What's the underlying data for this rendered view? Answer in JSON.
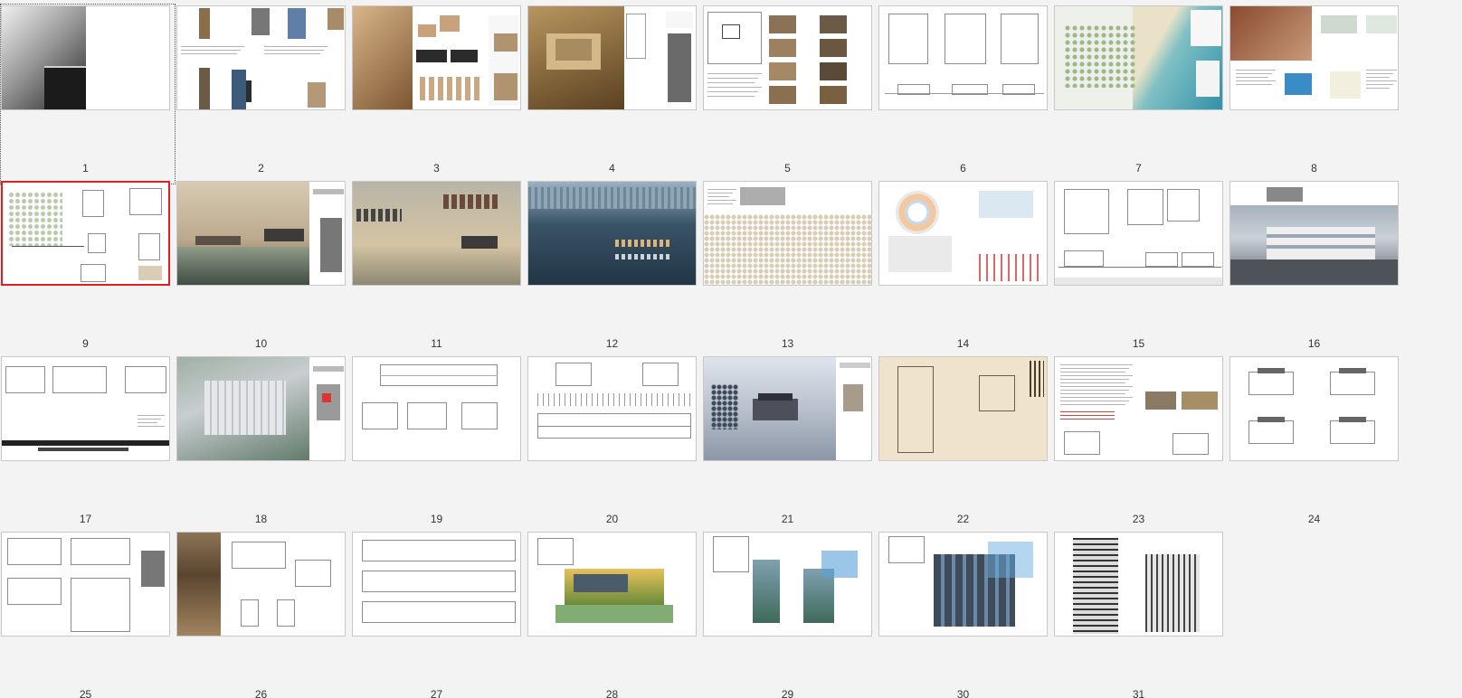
{
  "view": "slide-sorter",
  "selected_slide": 9,
  "slides": [
    {
      "number": "1",
      "theme": "gradient-title"
    },
    {
      "number": "2",
      "theme": "photo-collage"
    },
    {
      "number": "3",
      "theme": "model-photos"
    },
    {
      "number": "4",
      "theme": "model-aerial"
    },
    {
      "number": "5",
      "theme": "analysis-grid"
    },
    {
      "number": "6",
      "theme": "plans-sections"
    },
    {
      "number": "7",
      "theme": "site-plan-coast"
    },
    {
      "number": "8",
      "theme": "urban-analysis"
    },
    {
      "number": "9",
      "theme": "floor-plans"
    },
    {
      "number": "10",
      "theme": "waterfront-render"
    },
    {
      "number": "11",
      "theme": "waterfront-diagram"
    },
    {
      "number": "12",
      "theme": "night-bay"
    },
    {
      "number": "13",
      "theme": "sketch-map"
    },
    {
      "number": "14",
      "theme": "circle-diagram"
    },
    {
      "number": "15",
      "theme": "plans-elevations"
    },
    {
      "number": "16",
      "theme": "street-photo"
    },
    {
      "number": "17",
      "theme": "long-plans"
    },
    {
      "number": "18",
      "theme": "factory-aerial"
    },
    {
      "number": "19",
      "theme": "long-drawing"
    },
    {
      "number": "20",
      "theme": "elevations-sections"
    },
    {
      "number": "21",
      "theme": "snow-render"
    },
    {
      "number": "22",
      "theme": "parchment-plan"
    },
    {
      "number": "23",
      "theme": "pavilion-text"
    },
    {
      "number": "24",
      "theme": "pavilion-elevations"
    },
    {
      "number": "25",
      "theme": "interior-sketch"
    },
    {
      "number": "26",
      "theme": "photo-plan"
    },
    {
      "number": "27",
      "theme": "section-drawings"
    },
    {
      "number": "28",
      "theme": "watercolor-house"
    },
    {
      "number": "29",
      "theme": "watercolor-towers"
    },
    {
      "number": "30",
      "theme": "watercolor-cube"
    },
    {
      "number": "31",
      "theme": "ink-sketch"
    }
  ],
  "colors": {
    "background": "#f3f3f3",
    "selection": "#e02020",
    "thumb_border": "#c8c8c8"
  }
}
